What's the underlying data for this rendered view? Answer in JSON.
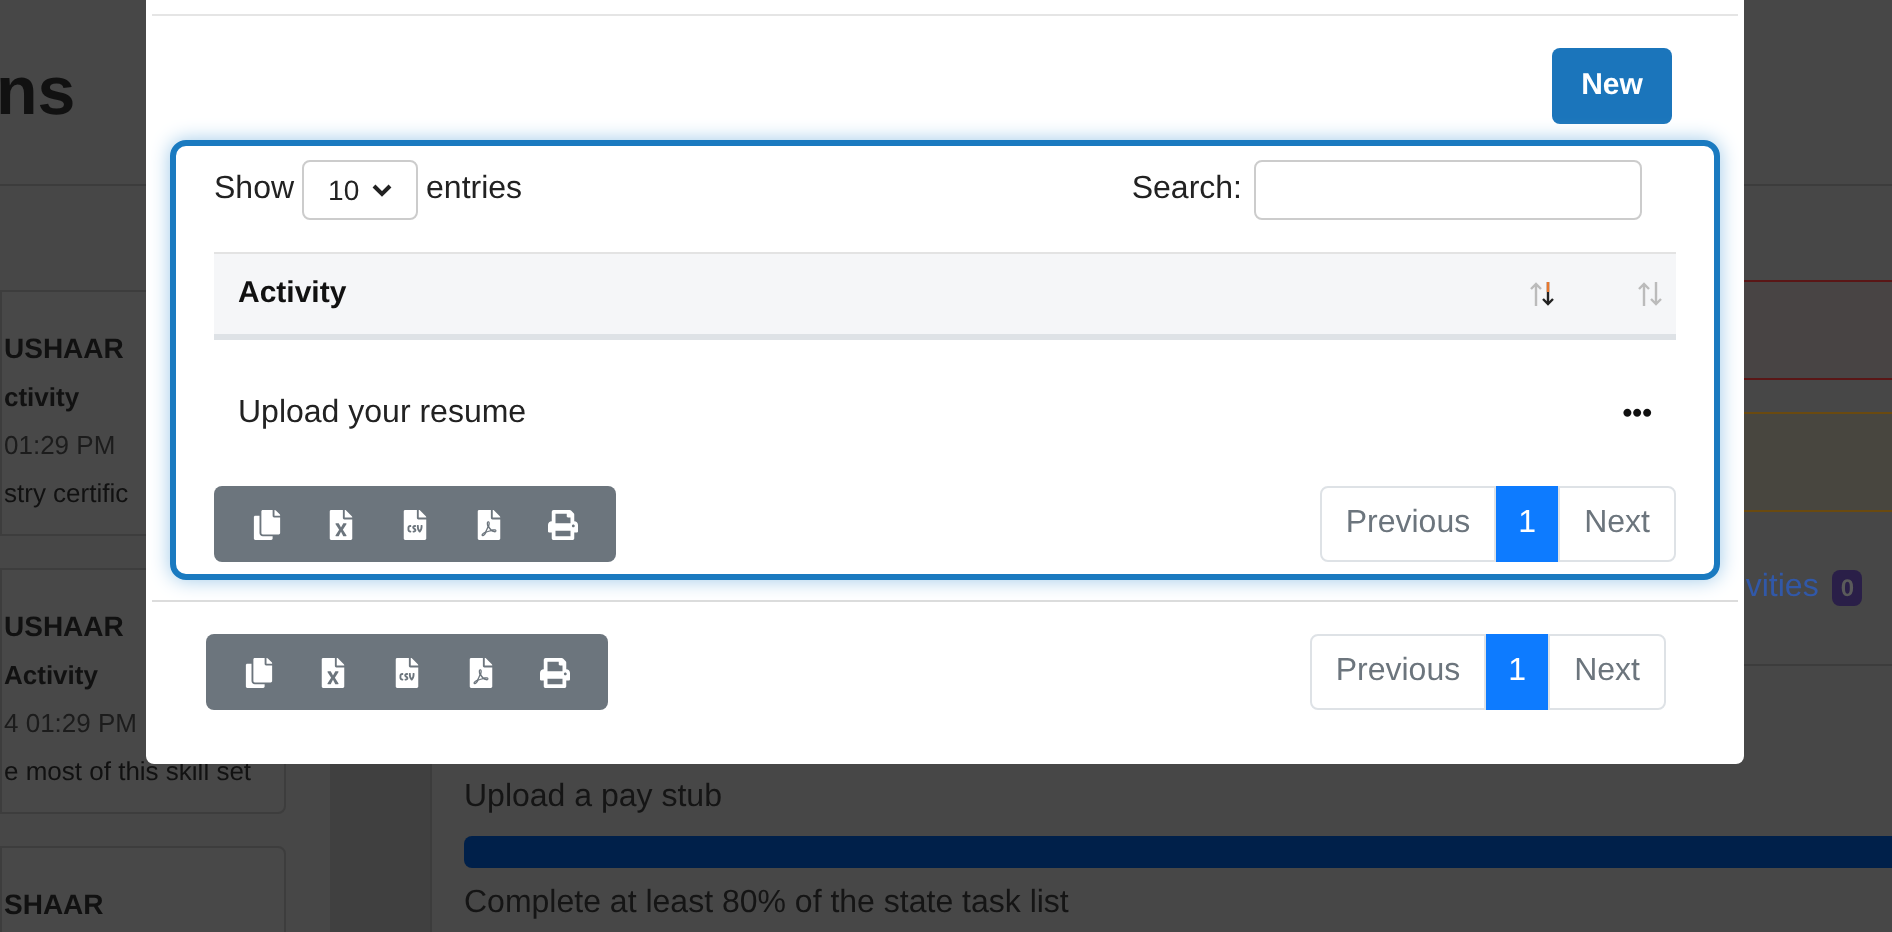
{
  "background": {
    "page_title": "ns",
    "feed": [
      {
        "name": "USHAAR",
        "type": "ctivity",
        "time": "01:29 PM",
        "text": "stry certific"
      },
      {
        "name": "USHAAR",
        "type": "Activity",
        "time": "4 01:29 PM",
        "text": "e most of this skill set"
      },
      {
        "name": "SHAAR"
      }
    ],
    "activities_link": "vities",
    "activities_count": "0",
    "tasks": [
      {
        "label": "Upload a pay stub",
        "level": 1
      },
      {
        "label": "Complete at least 80% of the state task list"
      }
    ]
  },
  "modal": {
    "new_button": "New",
    "panels": [
      {
        "show_label": "Show",
        "length": "10",
        "entries_label": "entries",
        "search_label": "Search:",
        "columns": [
          {
            "label": "Activity",
            "sorted": true
          },
          {
            "sorted": false
          }
        ],
        "rows": [
          {
            "activity": "Upload your resume",
            "action": "•••"
          }
        ],
        "export_buttons": [
          {
            "kind": "copy"
          },
          {
            "kind": "excel"
          },
          {
            "kind": "csv"
          },
          {
            "kind": "pdf"
          },
          {
            "kind": "print"
          }
        ],
        "pagination": {
          "previous": "Previous",
          "pages": [
            {
              "label": "1",
              "selected": true
            }
          ],
          "next": "Next"
        }
      }
    ],
    "footer": {
      "export_buttons": [
        {
          "kind": "copy"
        },
        {
          "kind": "excel"
        },
        {
          "kind": "csv"
        },
        {
          "kind": "pdf"
        },
        {
          "kind": "print"
        }
      ],
      "pagination": {
        "previous": "Previous",
        "pages": [
          {
            "label": "1",
            "selected": true
          }
        ],
        "next": "Next"
      }
    }
  }
}
